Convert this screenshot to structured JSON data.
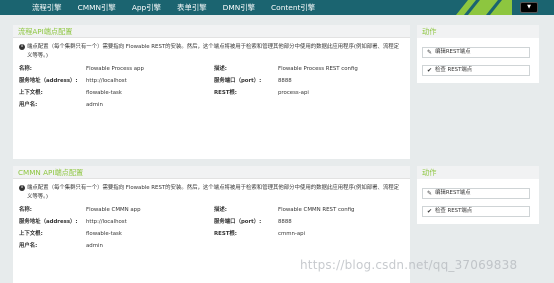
{
  "nav": {
    "items": [
      "流程引擎",
      "CMMN引擎",
      "App引擎",
      "表单引擎",
      "DMN引擎",
      "Content引擎"
    ],
    "menu_label": "▼"
  },
  "labels": {
    "name": "名称:",
    "address": "服务地址（address）:",
    "context_root": "上下文根:",
    "username": "用户名:",
    "description": "描述:",
    "port": "服务端口（port）:",
    "rest_root": "REST根:"
  },
  "panels": [
    {
      "title": "流程API端点配置",
      "notice": "端点配置（每个集群只有一个）需要指向 Flowable REST的安装。然后，这个端点将被用于检索和管理其他部分中使用的数据此应用程序(例如部署、流程定义等等。)",
      "name": "Flowable Process app",
      "address": "http://localhost",
      "context_root": "flowable-task",
      "username": "admin",
      "description": "Flowable Process REST config",
      "port": "8888",
      "rest_root": "process-api"
    },
    {
      "title": "CMMN API端点配置",
      "notice": "端点配置（每个集群只有一个）需要指向 Flowable REST的安装。然后，这个端点将被用于检索和管理其他部分中使用的数据此应用程序(例如部署、流程定义等等。)",
      "name": "Flowable CMMN app",
      "address": "http://localhost",
      "context_root": "flowable-task",
      "username": "admin",
      "description": "Flowable CMMN REST config",
      "port": "8888",
      "rest_root": "cmmn-api"
    }
  ],
  "actions": {
    "title": "动作",
    "edit": "编辑REST端点",
    "check": "检查 REST端点"
  },
  "watermark": "https://blog.csdn.net/qq_37069838"
}
